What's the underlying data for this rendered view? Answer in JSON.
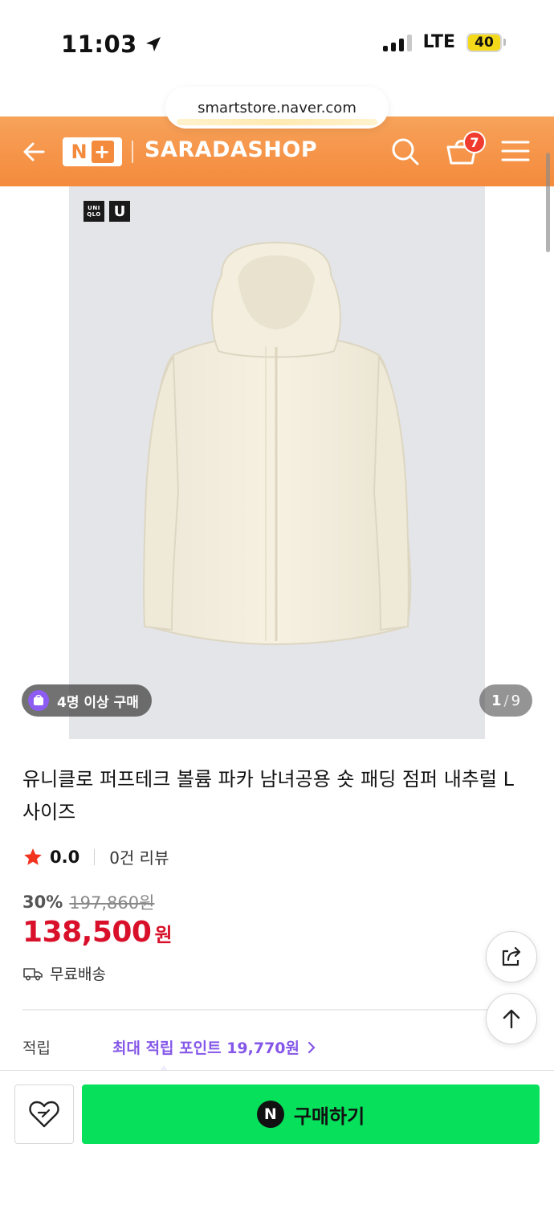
{
  "status": {
    "time": "11:03",
    "network": "LTE",
    "battery": "40",
    "signal_bars_active": 3
  },
  "browser": {
    "url": "smartstore.naver.com"
  },
  "header": {
    "brand_badge": "N",
    "brand_badge_plus": "+",
    "shop_name": "SARADASHOP",
    "cart_count": "7",
    "accent_color": "#f48a3c"
  },
  "gallery": {
    "brand_logo_top": "UNI",
    "brand_logo_bottom": "QLO",
    "brand_logo_u": "U",
    "buyers_badge": "4명 이상 구매",
    "page_current": "1",
    "page_separator": "/",
    "page_total": "9"
  },
  "product": {
    "title": "유니클로 퍼프테크 볼륨 파카 남녀공용 숏 패딩 점퍼 내추럴 L 사이즈",
    "rating_score": "0.0",
    "review_count": "0건 리뷰",
    "discount_rate": "30%",
    "original_price": "197,860원",
    "price": "138,500",
    "currency": "원",
    "shipping": "무료배송",
    "price_color": "#d8102a"
  },
  "points": {
    "label": "적립",
    "link": "최대 적립 포인트 19,770원",
    "link_color": "#8457e8"
  },
  "bottom_bar": {
    "buy_label": "구매하기",
    "buy_badge": "N",
    "buy_color": "#07e05a"
  },
  "icons": {
    "back": "back-arrow-icon",
    "search": "search-icon",
    "cart": "cart-icon",
    "menu": "hamburger-menu-icon",
    "share": "share-icon",
    "top": "arrow-up-icon",
    "wish": "heart-icon",
    "star": "star-icon",
    "truck": "truck-icon",
    "location": "location-arrow-icon"
  }
}
